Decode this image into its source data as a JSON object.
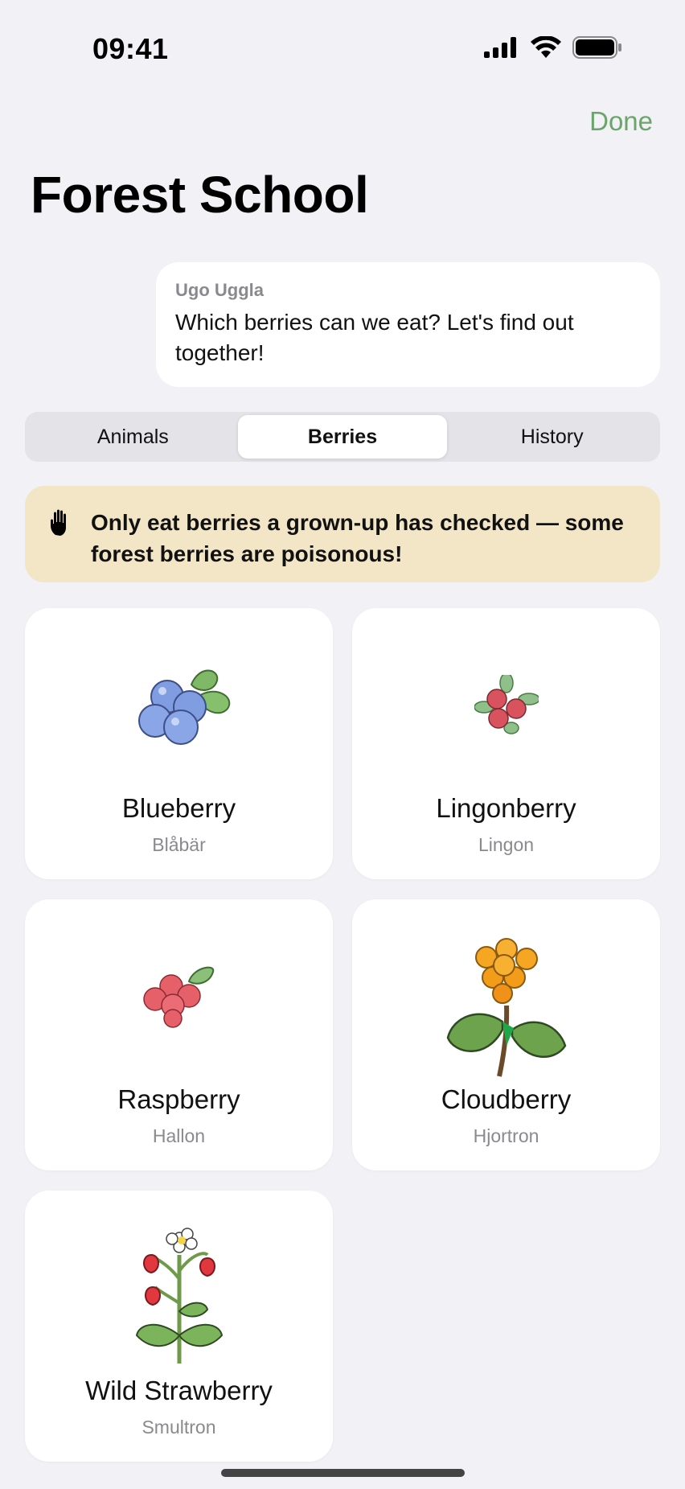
{
  "status_bar": {
    "time": "09:41"
  },
  "nav": {
    "done_label": "Done"
  },
  "page": {
    "title": "Forest School"
  },
  "message": {
    "sender": "Ugo Uggla",
    "text": "Which berries can we eat? Let's find out together!"
  },
  "tabs": [
    {
      "label": "Animals",
      "selected": false
    },
    {
      "label": "Berries",
      "selected": true
    },
    {
      "label": "History",
      "selected": false
    }
  ],
  "warning": {
    "icon": "hand-icon",
    "text": "Only eat berries a grown-up has checked — some forest berries are poisonous!"
  },
  "berries": [
    {
      "name": "Blueberry",
      "swedish": "Blåbär",
      "icon": "blueberry-icon"
    },
    {
      "name": "Lingonberry",
      "swedish": "Lingon",
      "icon": "lingonberry-icon"
    },
    {
      "name": "Raspberry",
      "swedish": "Hallon",
      "icon": "raspberry-icon"
    },
    {
      "name": "Cloudberry",
      "swedish": "Hjortron",
      "icon": "cloudberry-icon"
    },
    {
      "name": "Wild Strawberry",
      "swedish": "Smultron",
      "icon": "wild-strawberry-icon"
    }
  ],
  "colors": {
    "accent": "#6aa56a",
    "background": "#f1f1f6",
    "warning_bg": "#f3e6c6"
  }
}
